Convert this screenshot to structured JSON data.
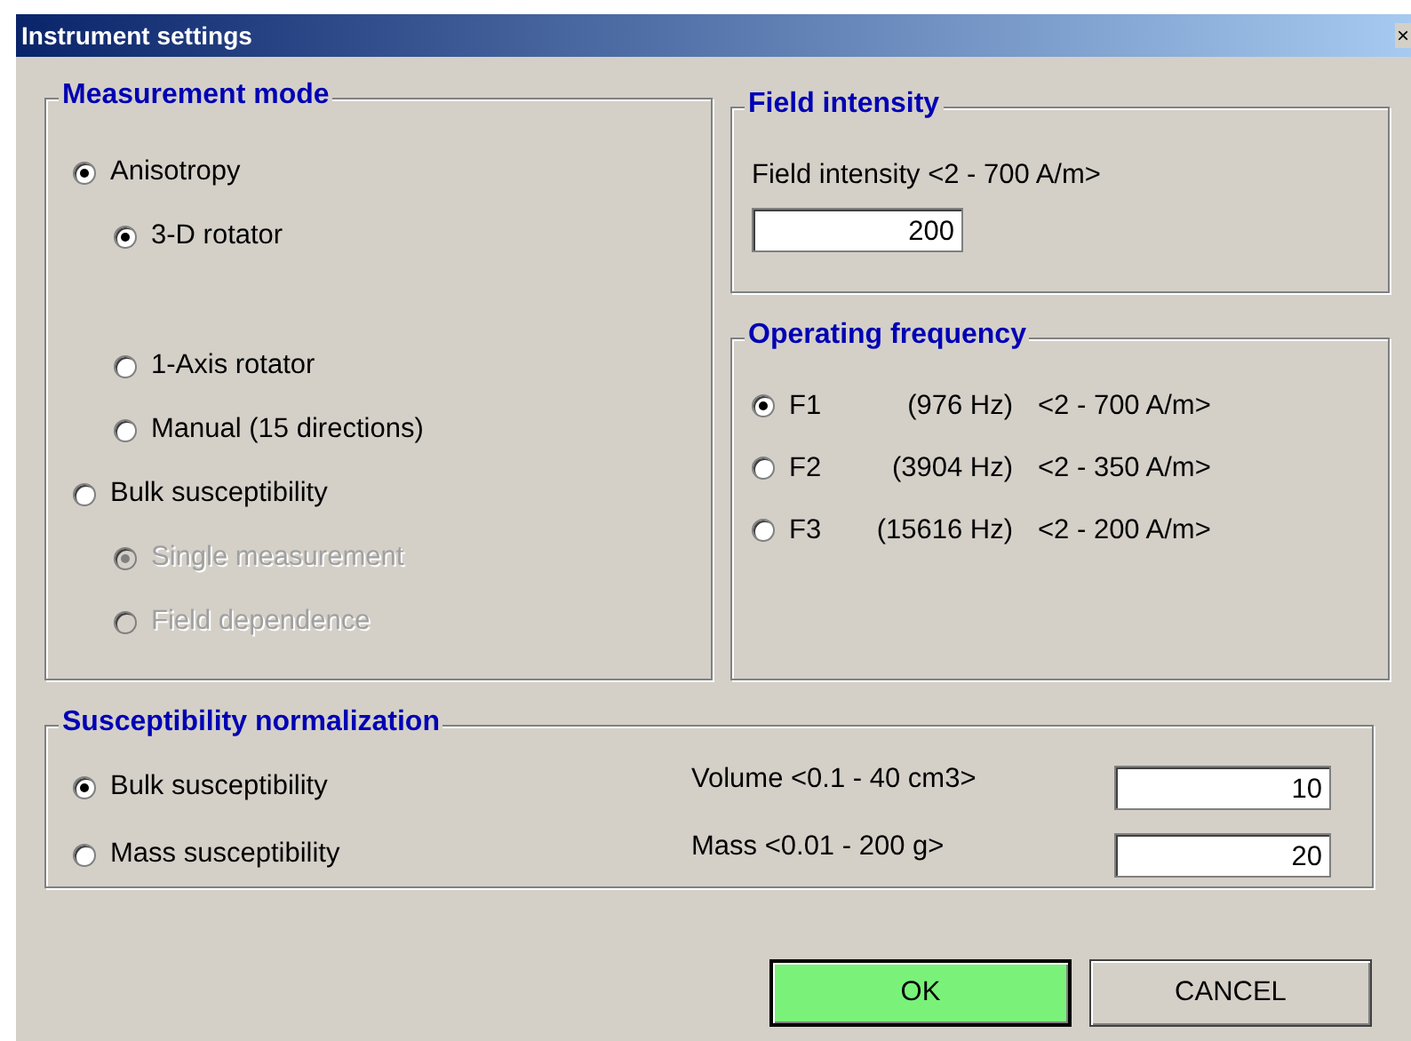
{
  "window": {
    "title": "Instrument settings",
    "close": "×"
  },
  "measurement_mode": {
    "title": "Measurement mode",
    "options": [
      {
        "label": "Anisotropy",
        "selected": true,
        "disabled": false,
        "children": [
          {
            "label": "3-D rotator",
            "selected": true,
            "disabled": false
          },
          {
            "label": "1-Axis rotator",
            "selected": false,
            "disabled": false
          },
          {
            "label": "Manual (15 directions)",
            "selected": false,
            "disabled": false
          }
        ]
      },
      {
        "label": "Bulk susceptibility",
        "selected": false,
        "disabled": false,
        "children": [
          {
            "label": "Single measurement",
            "selected": true,
            "disabled": true
          },
          {
            "label": "Field dependence",
            "selected": false,
            "disabled": true
          }
        ]
      }
    ]
  },
  "field_intensity": {
    "title": "Field intensity",
    "label": "Field intensity <2 - 700 A/m>",
    "value": "200"
  },
  "operating_frequency": {
    "title": "Operating frequency",
    "options": [
      {
        "name": "F1",
        "frequency": "(976 Hz)",
        "range": "<2 - 700 A/m>",
        "selected": true
      },
      {
        "name": "F2",
        "frequency": "(3904 Hz)",
        "range": "<2 - 350 A/m>",
        "selected": false
      },
      {
        "name": "F3",
        "frequency": "(15616 Hz)",
        "range": "<2 - 200 A/m>",
        "selected": false
      }
    ]
  },
  "susceptibility_normalization": {
    "title": "Susceptibility normalization",
    "rows": [
      {
        "label": "Bulk susceptibility",
        "selected": true,
        "field_label": "Volume <0.1 - 40 cm3>",
        "value": "10"
      },
      {
        "label": "Mass susceptibility",
        "selected": false,
        "field_label": "Mass <0.01 - 200 g>",
        "value": "20"
      }
    ]
  },
  "buttons": [
    {
      "label": "OK",
      "default": true
    },
    {
      "label": "CANCEL",
      "default": false
    }
  ]
}
